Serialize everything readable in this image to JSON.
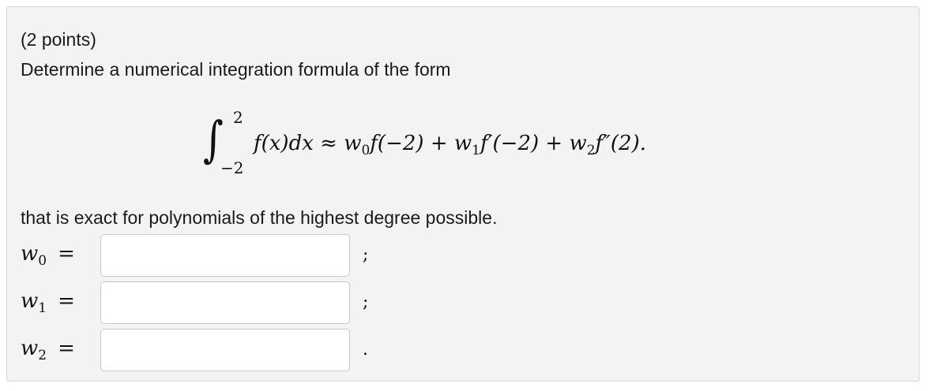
{
  "problem": {
    "points": "(2 points)",
    "prompt": "Determine a numerical integration formula of the form",
    "formula": {
      "integral_sign": "∫",
      "upper_limit": "2",
      "lower_limit": "−2",
      "integrand": "f(x)dx",
      "approx": "≈",
      "term0": {
        "weight": "w",
        "weight_sub": "0",
        "func": "f(−2)"
      },
      "plus1": "+",
      "term1": {
        "weight": "w",
        "weight_sub": "1",
        "func": "f′(−2)"
      },
      "plus2": "+",
      "term2": {
        "weight": "w",
        "weight_sub": "2",
        "func": "f″(2)."
      }
    },
    "exactness": "that is exact for polynomials of the highest degree possible."
  },
  "answers": [
    {
      "symbol": "w",
      "sub": "0",
      "equals": "=",
      "value": "",
      "separator": ";"
    },
    {
      "symbol": "w",
      "sub": "1",
      "equals": "=",
      "value": "",
      "separator": ";"
    },
    {
      "symbol": "w",
      "sub": "2",
      "equals": "=",
      "value": "",
      "separator": "."
    }
  ]
}
